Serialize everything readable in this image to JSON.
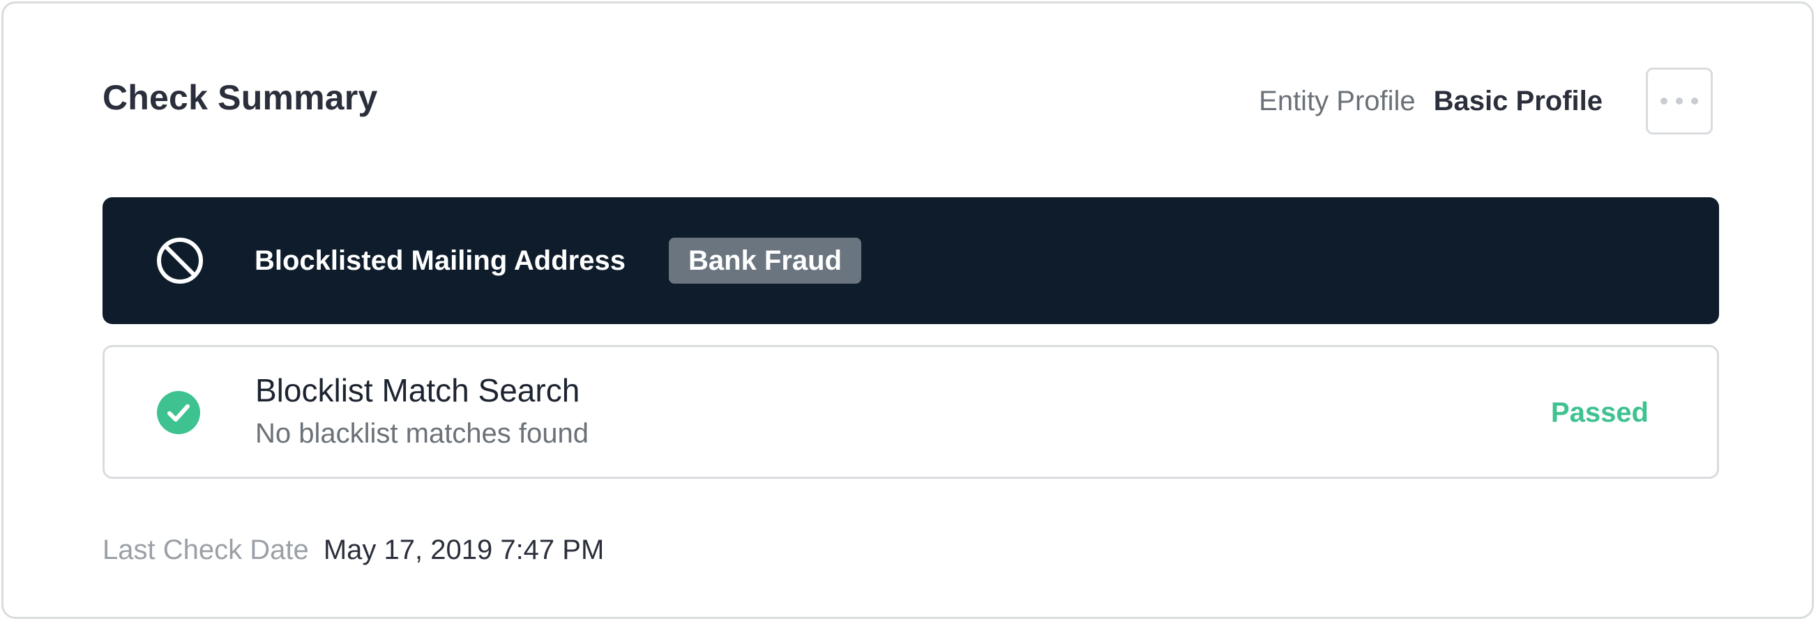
{
  "header": {
    "title": "Check Summary",
    "profile_label": "Entity Profile",
    "profile_value": "Basic Profile",
    "more_icon": "more-horizontal-icon"
  },
  "alert": {
    "icon": "block-icon",
    "title": "Blocklisted Mailing Address",
    "badge": "Bank Fraud",
    "background_color": "#0e1c2b",
    "badge_color": "#6b7580"
  },
  "check": {
    "icon": "check-circle-icon",
    "title": "Blocklist Match Search",
    "description": "No blacklist matches found",
    "status": "Passed",
    "status_color": "#3ec28f"
  },
  "footer": {
    "last_check_label": "Last Check Date",
    "last_check_value": "May 17, 2019 7:47 PM"
  }
}
